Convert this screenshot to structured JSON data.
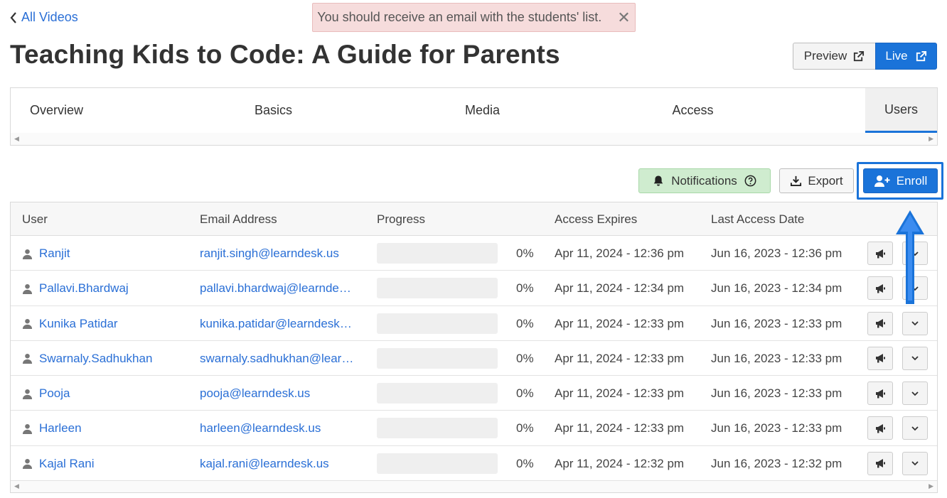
{
  "nav": {
    "back_label": "All Videos"
  },
  "toast": {
    "message": "You should receive an email with the students' list.",
    "close_glyph": "✕"
  },
  "page": {
    "title": "Teaching Kids to Code: A Guide for Parents"
  },
  "view_buttons": {
    "preview_label": "Preview",
    "live_label": "Live"
  },
  "tabs": [
    {
      "label": "Overview",
      "active": false
    },
    {
      "label": "Basics",
      "active": false
    },
    {
      "label": "Media",
      "active": false
    },
    {
      "label": "Access",
      "active": false
    },
    {
      "label": "Users",
      "active": true
    }
  ],
  "actions": {
    "notifications_label": "Notifications",
    "export_label": "Export",
    "enroll_label": "Enroll"
  },
  "table": {
    "headers": {
      "user": "User",
      "email": "Email Address",
      "progress": "Progress",
      "expires": "Access Expires",
      "last_access": "Last Access Date"
    },
    "rows": [
      {
        "user": "Ranjit",
        "email": "ranjit.singh@learndesk.us",
        "progress": "0%",
        "progress_value": 0,
        "expires": "Apr 11, 2024 - 12:36 pm",
        "last_access": "Jun 16, 2023 - 12:36 pm"
      },
      {
        "user": "Pallavi.Bhardwaj",
        "email": "pallavi.bhardwaj@learndesk…",
        "progress": "0%",
        "progress_value": 0,
        "expires": "Apr 11, 2024 - 12:34 pm",
        "last_access": "Jun 16, 2023 - 12:34 pm"
      },
      {
        "user": "Kunika Patidar",
        "email": "kunika.patidar@learndesk.us",
        "progress": "0%",
        "progress_value": 0,
        "expires": "Apr 11, 2024 - 12:33 pm",
        "last_access": "Jun 16, 2023 - 12:33 pm"
      },
      {
        "user": "Swarnaly.Sadhukhan",
        "email": "swarnaly.sadhukhan@learn…",
        "progress": "0%",
        "progress_value": 0,
        "expires": "Apr 11, 2024 - 12:33 pm",
        "last_access": "Jun 16, 2023 - 12:33 pm"
      },
      {
        "user": "Pooja",
        "email": "pooja@learndesk.us",
        "progress": "0%",
        "progress_value": 0,
        "expires": "Apr 11, 2024 - 12:33 pm",
        "last_access": "Jun 16, 2023 - 12:33 pm"
      },
      {
        "user": "Harleen",
        "email": "harleen@learndesk.us",
        "progress": "0%",
        "progress_value": 0,
        "expires": "Apr 11, 2024 - 12:33 pm",
        "last_access": "Jun 16, 2023 - 12:33 pm"
      },
      {
        "user": "Kajal Rani",
        "email": "kajal.rani@learndesk.us",
        "progress": "0%",
        "progress_value": 0,
        "expires": "Apr 11, 2024 - 12:32 pm",
        "last_access": "Jun 16, 2023 - 12:32 pm"
      }
    ]
  },
  "icons": {
    "back": "chevron-left-icon",
    "external": "external-link-icon",
    "bell": "bell-icon",
    "help": "question-circle-icon",
    "download": "download-icon",
    "user_plus": "user-plus-icon",
    "person": "person-icon",
    "megaphone": "megaphone-icon",
    "chevron": "chevron-down-icon",
    "pointer": "arrow-up-icon"
  },
  "colors": {
    "accent": "#1a73d9",
    "link": "#2a6fd6",
    "toast_bg": "#f6dcdc",
    "notif_bg": "#cfeccf",
    "progress_fill": "#4caf50"
  }
}
